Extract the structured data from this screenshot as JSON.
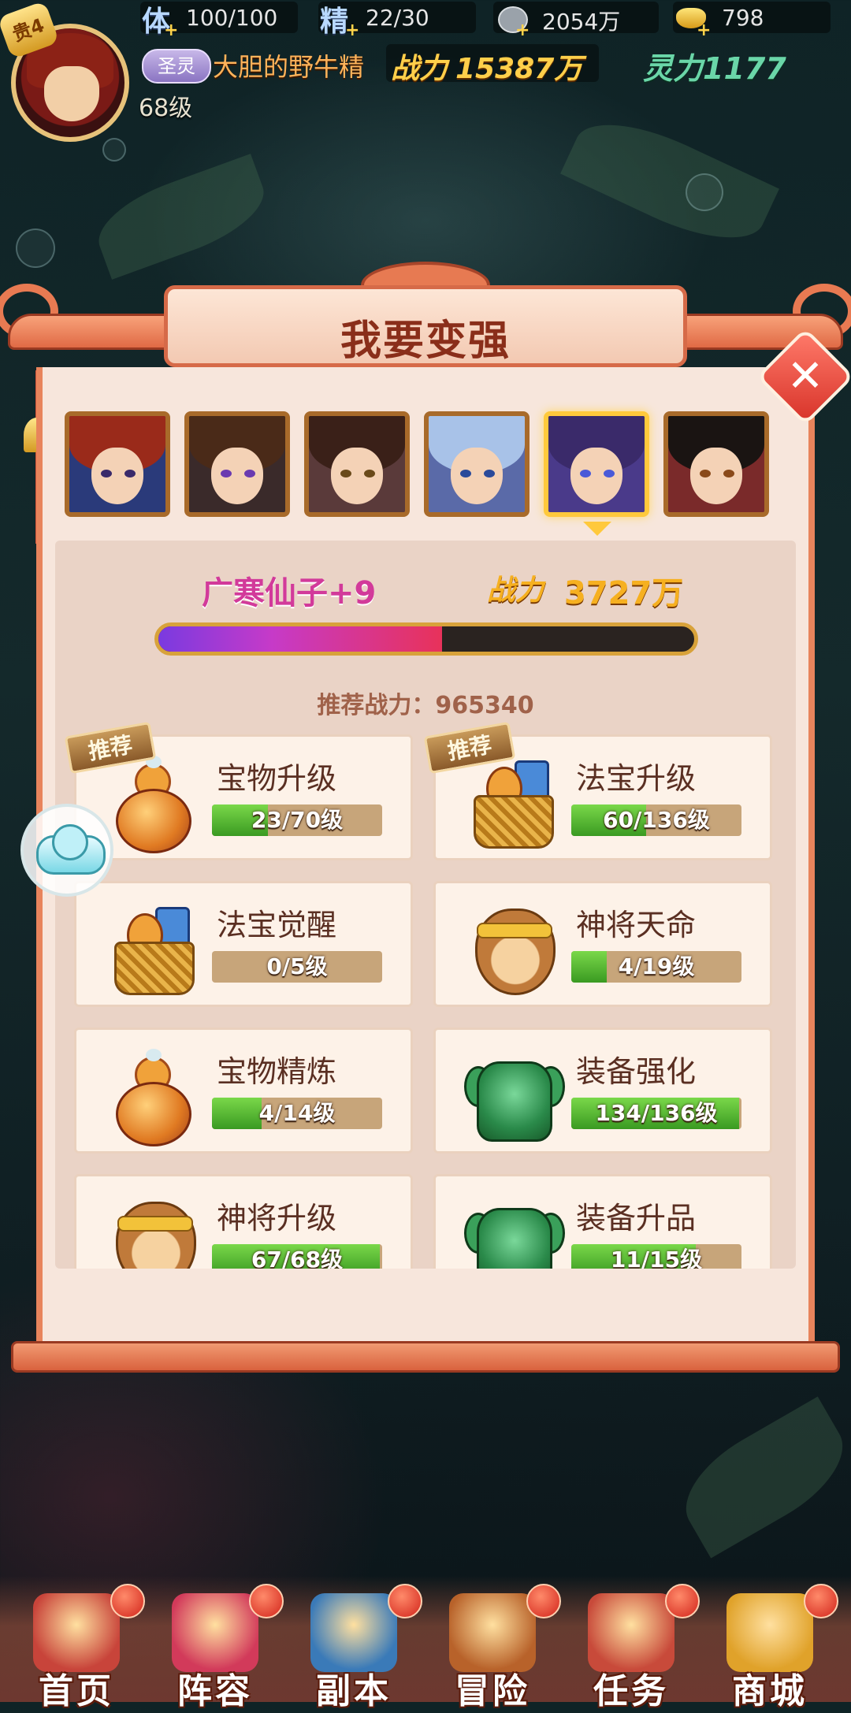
{
  "player": {
    "vip_label": "贵4",
    "level": "68级",
    "title_badge": "圣灵",
    "name": "大胆的野牛精",
    "power_label": "战力",
    "power_value": "15387万",
    "spirit_power": "灵力1177"
  },
  "resources": {
    "stamina_label": "体",
    "stamina_value": "100/100",
    "energy_label": "精",
    "energy_value": "22/30",
    "coins_value": "2054万",
    "ingots_value": "798",
    "plus": "+"
  },
  "panel": {
    "title": "我要变强",
    "close_symbol": "✕",
    "selected_hero_name": "广寒仙子+9",
    "power_label": "战力",
    "power_value": "3727万",
    "power_progress": 0.53,
    "recommend_text": "推荐战力：965340",
    "heroes": [
      {
        "id": "hero-1",
        "hair": "#9a2a1a",
        "eye": "#3a2a6a",
        "bg": "#2a3a7a"
      },
      {
        "id": "hero-2",
        "hair": "#4a2a18",
        "eye": "#6a3ab0",
        "bg": "#3a2a2a"
      },
      {
        "id": "hero-3",
        "hair": "#3a2018",
        "eye": "#6a4a1a",
        "bg": "#5a3a3a"
      },
      {
        "id": "hero-4",
        "hair": "#a8c2e8",
        "eye": "#2a4a9a",
        "bg": "#5a6aa8"
      },
      {
        "id": "hero-5",
        "hair": "#3a2a6a",
        "eye": "#4a5ad8",
        "bg": "#4a3a8a"
      },
      {
        "id": "hero-6",
        "hair": "#1a1412",
        "eye": "#8a4a1a",
        "bg": "#7a2a2a"
      }
    ],
    "selected_index": 4,
    "recommend_tag": "推荐",
    "items": [
      {
        "title": "宝物升级",
        "progress": "23/70级",
        "fraction": 0.33,
        "icon": "gourd-icon",
        "recommended": true
      },
      {
        "title": "法宝升级",
        "progress": "60/136级",
        "fraction": 0.44,
        "icon": "treasure-basket-icon",
        "recommended": true
      },
      {
        "title": "法宝觉醒",
        "progress": "0/5级",
        "fraction": 0.0,
        "icon": "treasure-basket-icon",
        "recommended": false
      },
      {
        "title": "神将天命",
        "progress": "4/19级",
        "fraction": 0.21,
        "icon": "monkey-king-icon",
        "recommended": false
      },
      {
        "title": "宝物精炼",
        "progress": "4/14级",
        "fraction": 0.29,
        "icon": "gourd-icon",
        "recommended": false
      },
      {
        "title": "装备强化",
        "progress": "134/136级",
        "fraction": 0.985,
        "icon": "armor-icon",
        "recommended": false
      },
      {
        "title": "神将升级",
        "progress": "67/68级",
        "fraction": 0.985,
        "icon": "monkey-king-icon",
        "recommended": false
      },
      {
        "title": "装备升品",
        "progress": "11/15级",
        "fraction": 0.73,
        "icon": "armor-icon",
        "recommended": false
      }
    ]
  },
  "nav": [
    {
      "label": "首页",
      "icon": "home-icon",
      "color": "#c8443a"
    },
    {
      "label": "阵容",
      "icon": "lineup-icon",
      "color": "#d23a5a"
    },
    {
      "label": "副本",
      "icon": "dungeon-icon",
      "color": "#3a7ab8"
    },
    {
      "label": "冒险",
      "icon": "adventure-icon",
      "color": "#b8622a"
    },
    {
      "label": "任务",
      "icon": "quest-icon",
      "color": "#c84a3a"
    },
    {
      "label": "商城",
      "icon": "shop-icon",
      "color": "#e0a22a"
    }
  ]
}
